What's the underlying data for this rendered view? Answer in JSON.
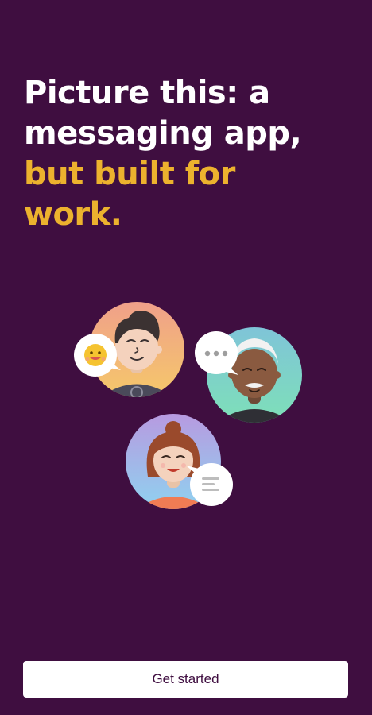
{
  "onboarding": {
    "headline_line1": "Picture this: a",
    "headline_line2": "messaging app,",
    "headline_line3": "but built for",
    "headline_line4": "work.",
    "illustration": {
      "people": [
        "person-man-dark-hair",
        "person-older-man-white-hair",
        "person-woman-red-hair"
      ],
      "bubbles": [
        "emoji-bubble-icon",
        "typing-dots-bubble-icon",
        "message-lines-bubble-icon"
      ]
    },
    "get_started_label": "Get started"
  },
  "colors": {
    "background": "#3f0e40",
    "headline_white": "#ffffff",
    "headline_accent": "#ecb22e",
    "button_bg": "#ffffff",
    "button_text": "#3f0e40"
  }
}
